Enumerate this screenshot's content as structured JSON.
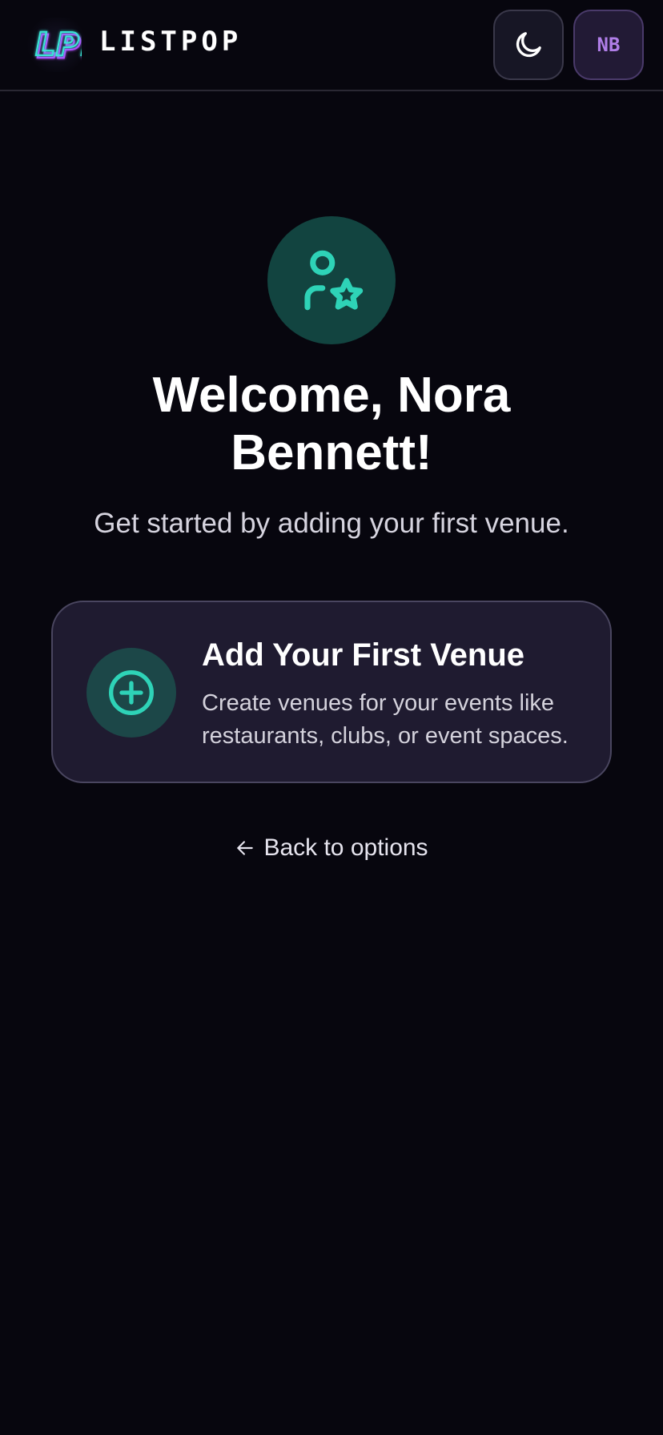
{
  "header": {
    "logo_text": "LP!",
    "brand": "LISTPOP",
    "theme_icon": "moon-icon",
    "avatar_initials": "NB"
  },
  "main": {
    "hero_icon": "user-star-icon",
    "welcome": "Welcome, Nora Bennett!",
    "subtitle": "Get started by adding your first venue."
  },
  "card": {
    "icon": "plus-circle-icon",
    "title": "Add Your First Venue",
    "description": "Create venues for your events like restaurants, clubs, or event spaces."
  },
  "back_link": {
    "icon": "arrow-left-icon",
    "label": "Back to options"
  },
  "colors": {
    "background": "#07060e",
    "accent_teal": "#2ed3b7",
    "accent_purple": "#b07ee8",
    "card_bg": "#1f1b30"
  }
}
